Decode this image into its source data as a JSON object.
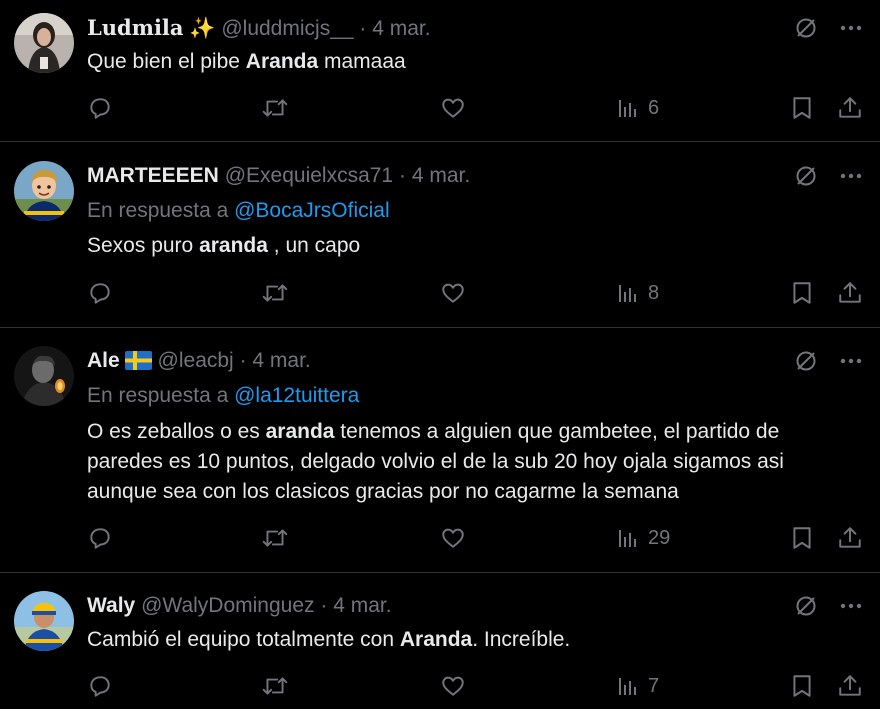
{
  "tweets": [
    {
      "name": "Ludmila",
      "name_emoji": "✨",
      "handle": "@luddmicjs__",
      "separator": "·",
      "date": "4 mar.",
      "reply_prefix": "",
      "reply_to": "",
      "text_parts": [
        "Que bien el pibe ",
        "Aranda",
        " mamaaa"
      ],
      "views": "6"
    },
    {
      "name": "MARTEEEEN",
      "handle": "@Exequielxcsa71",
      "separator": "·",
      "date": "4 mar.",
      "reply_prefix": "En respuesta a ",
      "reply_to": "@BocaJrsOficial",
      "text_parts": [
        "Sexos puro ",
        "aranda",
        " , un capo"
      ],
      "views": "8"
    },
    {
      "name": "Ale",
      "handle": "@leacbj",
      "separator": "·",
      "date": "4 mar.",
      "reply_prefix": "En respuesta a ",
      "reply_to": "@la12tuittera",
      "text_parts": [
        "O es zeballos o es ",
        "aranda",
        " tenemos a alguien que gambetee, el partido de paredes es 10 puntos, delgado volvio el de la sub 20 hoy ojala sigamos asi aunque sea con los clasicos gracias por no cagarme la semana"
      ],
      "views": "29"
    },
    {
      "name": "Waly",
      "handle": "@WalyDominguez",
      "separator": "·",
      "date": "4 mar.",
      "reply_prefix": "",
      "reply_to": "",
      "text_parts": [
        "Cambió el equipo totalmente con ",
        "Aranda",
        ". Increíble."
      ],
      "views": "7"
    }
  ],
  "icons": {
    "grok": "grok-icon",
    "more": "more-icon",
    "reply": "reply-icon",
    "retweet": "retweet-icon",
    "like": "like-icon",
    "views": "views-icon",
    "bookmark": "bookmark-icon",
    "share": "share-icon"
  },
  "colors": {
    "background": "#000000",
    "text": "#e7e9ea",
    "muted": "#71767b",
    "link": "#1d9bf0",
    "divider": "#2f3336"
  }
}
